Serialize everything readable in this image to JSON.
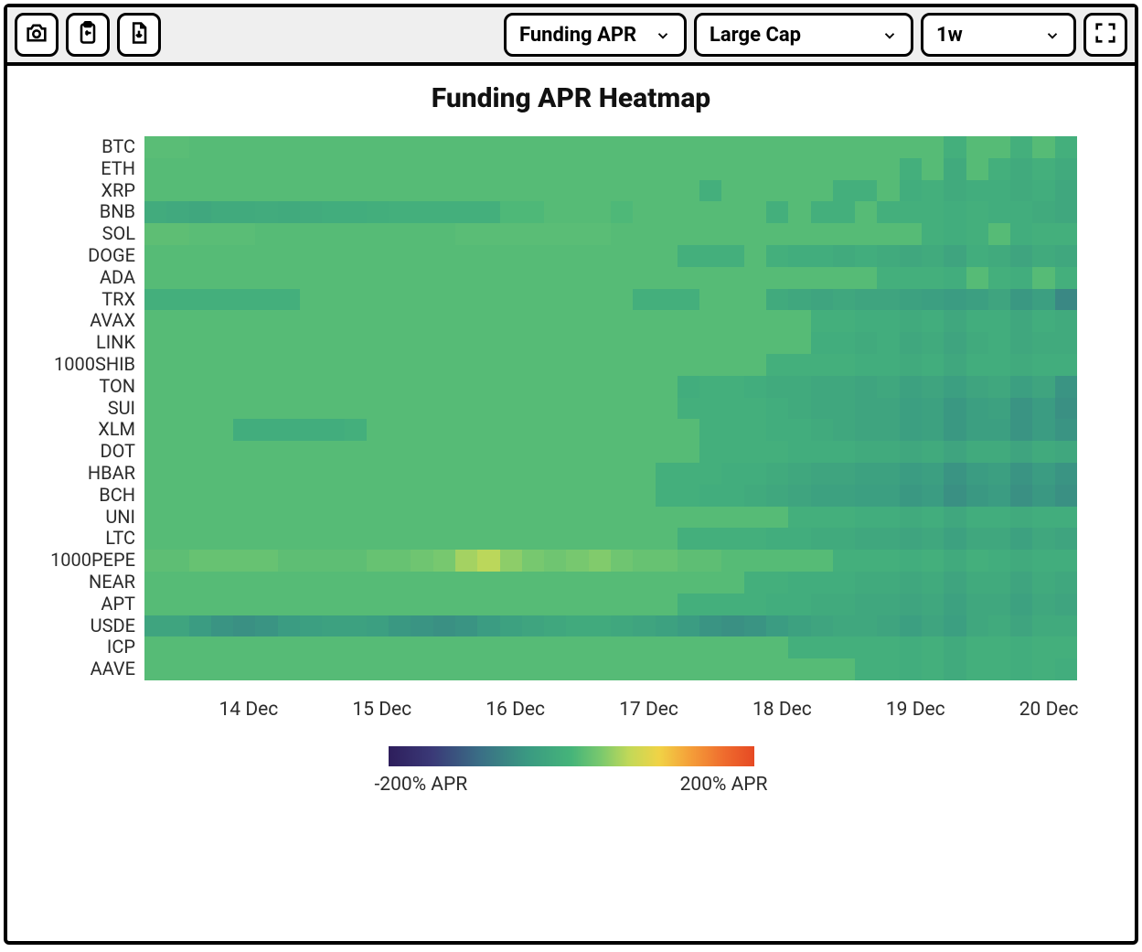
{
  "toolbar": {
    "metric_select": "Funding APR",
    "cap_select": "Large Cap",
    "range_select": "1w"
  },
  "chart_data": {
    "type": "heatmap",
    "title": "Funding APR Heatmap",
    "xlabel": "",
    "ylabel": "",
    "x_ticks": [
      "14 Dec",
      "15 Dec",
      "16 Dec",
      "17 Dec",
      "18 Dec",
      "19 Dec",
      "20 Dec"
    ],
    "x_count": 42,
    "y_labels": [
      "BTC",
      "ETH",
      "XRP",
      "BNB",
      "SOL",
      "DOGE",
      "ADA",
      "TRX",
      "AVAX",
      "LINK",
      "1000SHIB",
      "TON",
      "SUI",
      "XLM",
      "DOT",
      "HBAR",
      "BCH",
      "UNI",
      "LTC",
      "1000PEPE",
      "NEAR",
      "APT",
      "USDE",
      "ICP",
      "AAVE"
    ],
    "color_scale": {
      "min": -200,
      "max": 200,
      "unit": "% APR",
      "min_label": "-200% APR",
      "max_label": "200% APR",
      "stops": [
        {
          "t": 0.0,
          "c": "#2e1e5c"
        },
        {
          "t": 0.12,
          "c": "#3b3a78"
        },
        {
          "t": 0.25,
          "c": "#3a6f86"
        },
        {
          "t": 0.38,
          "c": "#3a9a82"
        },
        {
          "t": 0.5,
          "c": "#46b57a"
        },
        {
          "t": 0.58,
          "c": "#7ac96e"
        },
        {
          "t": 0.66,
          "c": "#c4d958"
        },
        {
          "t": 0.74,
          "c": "#f1d346"
        },
        {
          "t": 0.82,
          "c": "#f5a23a"
        },
        {
          "t": 0.92,
          "c": "#ef6b2e"
        },
        {
          "t": 1.0,
          "c": "#e64a24"
        }
      ]
    },
    "values_note": "values are approximate Funding APR (%) read from the heatmap color; 42 columns cover the 1-week range (~4h bins).",
    "values": [
      [
        12,
        12,
        10,
        10,
        10,
        10,
        10,
        10,
        10,
        10,
        10,
        10,
        10,
        10,
        10,
        10,
        10,
        10,
        10,
        10,
        10,
        10,
        10,
        10,
        10,
        10,
        10,
        10,
        10,
        10,
        10,
        10,
        10,
        10,
        10,
        10,
        -10,
        10,
        10,
        -10,
        10,
        -10
      ],
      [
        10,
        10,
        10,
        10,
        10,
        10,
        10,
        10,
        10,
        10,
        10,
        10,
        10,
        10,
        10,
        10,
        10,
        10,
        10,
        10,
        10,
        10,
        10,
        10,
        10,
        10,
        10,
        10,
        10,
        10,
        10,
        10,
        10,
        10,
        -10,
        10,
        -20,
        10,
        -10,
        -20,
        -10,
        -20
      ],
      [
        10,
        10,
        10,
        10,
        10,
        10,
        10,
        10,
        10,
        10,
        10,
        10,
        10,
        10,
        10,
        10,
        10,
        10,
        10,
        10,
        10,
        10,
        10,
        10,
        10,
        -10,
        10,
        10,
        10,
        10,
        10,
        -10,
        -10,
        10,
        -15,
        -10,
        -20,
        -15,
        -15,
        -20,
        -15,
        -25
      ],
      [
        -18,
        -22,
        -25,
        -20,
        -20,
        -18,
        -20,
        -18,
        -15,
        -15,
        -12,
        -10,
        -10,
        -10,
        -10,
        -10,
        5,
        5,
        10,
        10,
        10,
        5,
        10,
        10,
        10,
        10,
        10,
        10,
        -10,
        10,
        -10,
        -10,
        10,
        -10,
        -10,
        -10,
        -15,
        -10,
        -15,
        -15,
        -20,
        -25
      ],
      [
        15,
        15,
        12,
        12,
        12,
        10,
        10,
        10,
        10,
        10,
        10,
        10,
        10,
        10,
        12,
        12,
        12,
        12,
        12,
        12,
        12,
        10,
        10,
        10,
        10,
        10,
        10,
        10,
        10,
        10,
        10,
        10,
        10,
        10,
        10,
        -10,
        -15,
        -10,
        10,
        -15,
        -10,
        -10
      ],
      [
        10,
        10,
        10,
        10,
        10,
        10,
        10,
        10,
        10,
        10,
        10,
        10,
        10,
        10,
        10,
        10,
        10,
        10,
        10,
        10,
        10,
        10,
        10,
        10,
        -10,
        -10,
        -10,
        10,
        -10,
        -15,
        -15,
        -20,
        -15,
        -20,
        -25,
        -20,
        -30,
        -15,
        -20,
        -30,
        -20,
        -25
      ],
      [
        10,
        10,
        10,
        10,
        10,
        10,
        10,
        10,
        10,
        10,
        10,
        10,
        10,
        10,
        10,
        10,
        10,
        10,
        10,
        10,
        10,
        10,
        10,
        10,
        10,
        10,
        10,
        10,
        10,
        10,
        10,
        10,
        10,
        -10,
        -10,
        -10,
        -15,
        10,
        -10,
        -15,
        10,
        -10
      ],
      [
        -10,
        -10,
        -10,
        -10,
        -10,
        -10,
        -10,
        10,
        10,
        10,
        10,
        10,
        10,
        10,
        10,
        10,
        10,
        10,
        10,
        10,
        10,
        10,
        -10,
        -10,
        -10,
        10,
        10,
        10,
        -20,
        -25,
        -30,
        -25,
        -30,
        -30,
        -35,
        -40,
        -45,
        -40,
        -30,
        -50,
        -40,
        -70
      ],
      [
        10,
        10,
        10,
        10,
        10,
        10,
        10,
        10,
        10,
        10,
        10,
        10,
        10,
        10,
        10,
        10,
        10,
        10,
        10,
        10,
        10,
        10,
        10,
        10,
        10,
        10,
        10,
        10,
        10,
        10,
        -10,
        -10,
        -15,
        -15,
        -20,
        -15,
        -25,
        -15,
        -15,
        -25,
        -15,
        -20
      ],
      [
        10,
        10,
        10,
        10,
        10,
        10,
        10,
        10,
        10,
        10,
        10,
        10,
        10,
        10,
        10,
        10,
        10,
        10,
        10,
        10,
        10,
        10,
        10,
        10,
        10,
        10,
        10,
        10,
        10,
        10,
        -15,
        -15,
        -20,
        -15,
        -25,
        -20,
        -30,
        -20,
        -15,
        -25,
        -20,
        -20
      ],
      [
        10,
        10,
        10,
        10,
        10,
        10,
        10,
        10,
        10,
        10,
        10,
        10,
        10,
        10,
        10,
        10,
        10,
        10,
        10,
        10,
        10,
        10,
        10,
        10,
        10,
        10,
        10,
        10,
        -10,
        -10,
        -10,
        -10,
        -15,
        -15,
        -20,
        -15,
        -25,
        -15,
        -15,
        -20,
        -15,
        -15
      ],
      [
        10,
        10,
        10,
        10,
        10,
        10,
        10,
        10,
        10,
        10,
        10,
        10,
        10,
        10,
        10,
        10,
        10,
        10,
        10,
        10,
        10,
        10,
        10,
        10,
        -15,
        -10,
        -10,
        -15,
        -20,
        -20,
        -25,
        -25,
        -30,
        -25,
        -35,
        -30,
        -40,
        -30,
        -25,
        -40,
        -30,
        -55
      ],
      [
        10,
        10,
        10,
        10,
        10,
        10,
        10,
        10,
        10,
        10,
        10,
        10,
        10,
        10,
        10,
        10,
        10,
        10,
        10,
        10,
        10,
        10,
        10,
        10,
        -10,
        -10,
        -10,
        -10,
        -15,
        -20,
        -25,
        -25,
        -30,
        -30,
        -40,
        -35,
        -50,
        -40,
        -35,
        -55,
        -45,
        -60
      ],
      [
        10,
        10,
        10,
        10,
        -15,
        -15,
        -15,
        -15,
        -15,
        -10,
        10,
        10,
        10,
        10,
        10,
        10,
        10,
        10,
        10,
        10,
        10,
        10,
        10,
        10,
        10,
        -10,
        -10,
        -10,
        -15,
        -15,
        -20,
        -25,
        -30,
        -30,
        -40,
        -35,
        -50,
        -40,
        -40,
        -55,
        -45,
        -55
      ],
      [
        10,
        10,
        10,
        10,
        10,
        10,
        10,
        10,
        10,
        10,
        10,
        10,
        10,
        10,
        10,
        10,
        10,
        10,
        10,
        10,
        10,
        10,
        10,
        10,
        10,
        -10,
        -10,
        -10,
        -10,
        -15,
        -15,
        -15,
        -20,
        -20,
        -25,
        -20,
        -30,
        -20,
        -20,
        -30,
        -20,
        -25
      ],
      [
        10,
        10,
        10,
        10,
        10,
        10,
        10,
        10,
        10,
        10,
        10,
        10,
        10,
        10,
        10,
        10,
        10,
        10,
        10,
        10,
        10,
        10,
        10,
        -10,
        -10,
        -10,
        -15,
        -15,
        -20,
        -25,
        -30,
        -30,
        -35,
        -35,
        -45,
        -40,
        -55,
        -45,
        -40,
        -55,
        -45,
        -55
      ],
      [
        10,
        10,
        10,
        10,
        10,
        10,
        10,
        10,
        10,
        10,
        10,
        10,
        10,
        10,
        10,
        10,
        10,
        10,
        10,
        10,
        10,
        10,
        10,
        -10,
        -10,
        -15,
        -15,
        -20,
        -25,
        -30,
        -35,
        -35,
        -40,
        -40,
        -50,
        -45,
        -60,
        -50,
        -45,
        -60,
        -50,
        -60
      ],
      [
        10,
        10,
        10,
        10,
        10,
        10,
        10,
        10,
        10,
        10,
        10,
        10,
        10,
        10,
        10,
        10,
        10,
        10,
        10,
        10,
        10,
        10,
        10,
        10,
        10,
        10,
        10,
        10,
        10,
        -10,
        -10,
        -10,
        -15,
        -15,
        -20,
        -15,
        -25,
        -15,
        -15,
        -20,
        -15,
        -15
      ],
      [
        10,
        10,
        10,
        10,
        10,
        10,
        10,
        10,
        10,
        10,
        10,
        10,
        10,
        10,
        10,
        10,
        10,
        10,
        10,
        10,
        10,
        10,
        10,
        10,
        -10,
        -10,
        -10,
        -10,
        -15,
        -15,
        -20,
        -20,
        -25,
        -25,
        -30,
        -25,
        -35,
        -25,
        -25,
        -35,
        -25,
        -30
      ],
      [
        15,
        15,
        20,
        20,
        20,
        20,
        15,
        15,
        15,
        15,
        20,
        20,
        25,
        30,
        50,
        60,
        40,
        30,
        25,
        30,
        35,
        25,
        20,
        20,
        15,
        15,
        10,
        10,
        10,
        10,
        10,
        -10,
        -10,
        -10,
        -15,
        -10,
        -20,
        -10,
        -15,
        -20,
        -15,
        -15
      ],
      [
        10,
        10,
        10,
        10,
        10,
        10,
        10,
        10,
        10,
        10,
        10,
        10,
        10,
        10,
        10,
        10,
        10,
        10,
        10,
        10,
        10,
        10,
        10,
        10,
        10,
        10,
        10,
        -10,
        -10,
        -15,
        -15,
        -15,
        -20,
        -20,
        -25,
        -20,
        -30,
        -20,
        -20,
        -30,
        -20,
        -25
      ],
      [
        10,
        10,
        10,
        10,
        10,
        10,
        10,
        10,
        10,
        10,
        10,
        10,
        10,
        10,
        10,
        10,
        10,
        10,
        10,
        10,
        10,
        10,
        10,
        10,
        -10,
        -10,
        -10,
        -10,
        -15,
        -15,
        -20,
        -20,
        -25,
        -25,
        -30,
        -25,
        -35,
        -25,
        -25,
        -35,
        -25,
        -30
      ],
      [
        -30,
        -30,
        -45,
        -55,
        -60,
        -55,
        -45,
        -40,
        -35,
        -35,
        -40,
        -50,
        -55,
        -60,
        -55,
        -45,
        -35,
        -30,
        -25,
        -20,
        -20,
        -25,
        -30,
        -35,
        -45,
        -55,
        -60,
        -55,
        -45,
        -35,
        -30,
        -25,
        -25,
        -30,
        -40,
        -30,
        -40,
        -25,
        -20,
        -30,
        -20,
        -20
      ],
      [
        10,
        10,
        10,
        10,
        10,
        10,
        10,
        10,
        10,
        10,
        10,
        10,
        10,
        10,
        10,
        10,
        10,
        10,
        10,
        10,
        10,
        10,
        10,
        10,
        10,
        10,
        10,
        10,
        10,
        -10,
        -10,
        -10,
        -10,
        -10,
        -15,
        -10,
        -20,
        -10,
        -10,
        -15,
        -10,
        -10
      ],
      [
        10,
        10,
        10,
        10,
        10,
        10,
        10,
        10,
        10,
        10,
        10,
        10,
        10,
        10,
        10,
        10,
        10,
        10,
        10,
        10,
        10,
        10,
        10,
        10,
        10,
        10,
        10,
        10,
        10,
        10,
        10,
        10,
        -10,
        -10,
        -15,
        -10,
        -20,
        -10,
        -10,
        -15,
        -10,
        -15
      ]
    ]
  }
}
